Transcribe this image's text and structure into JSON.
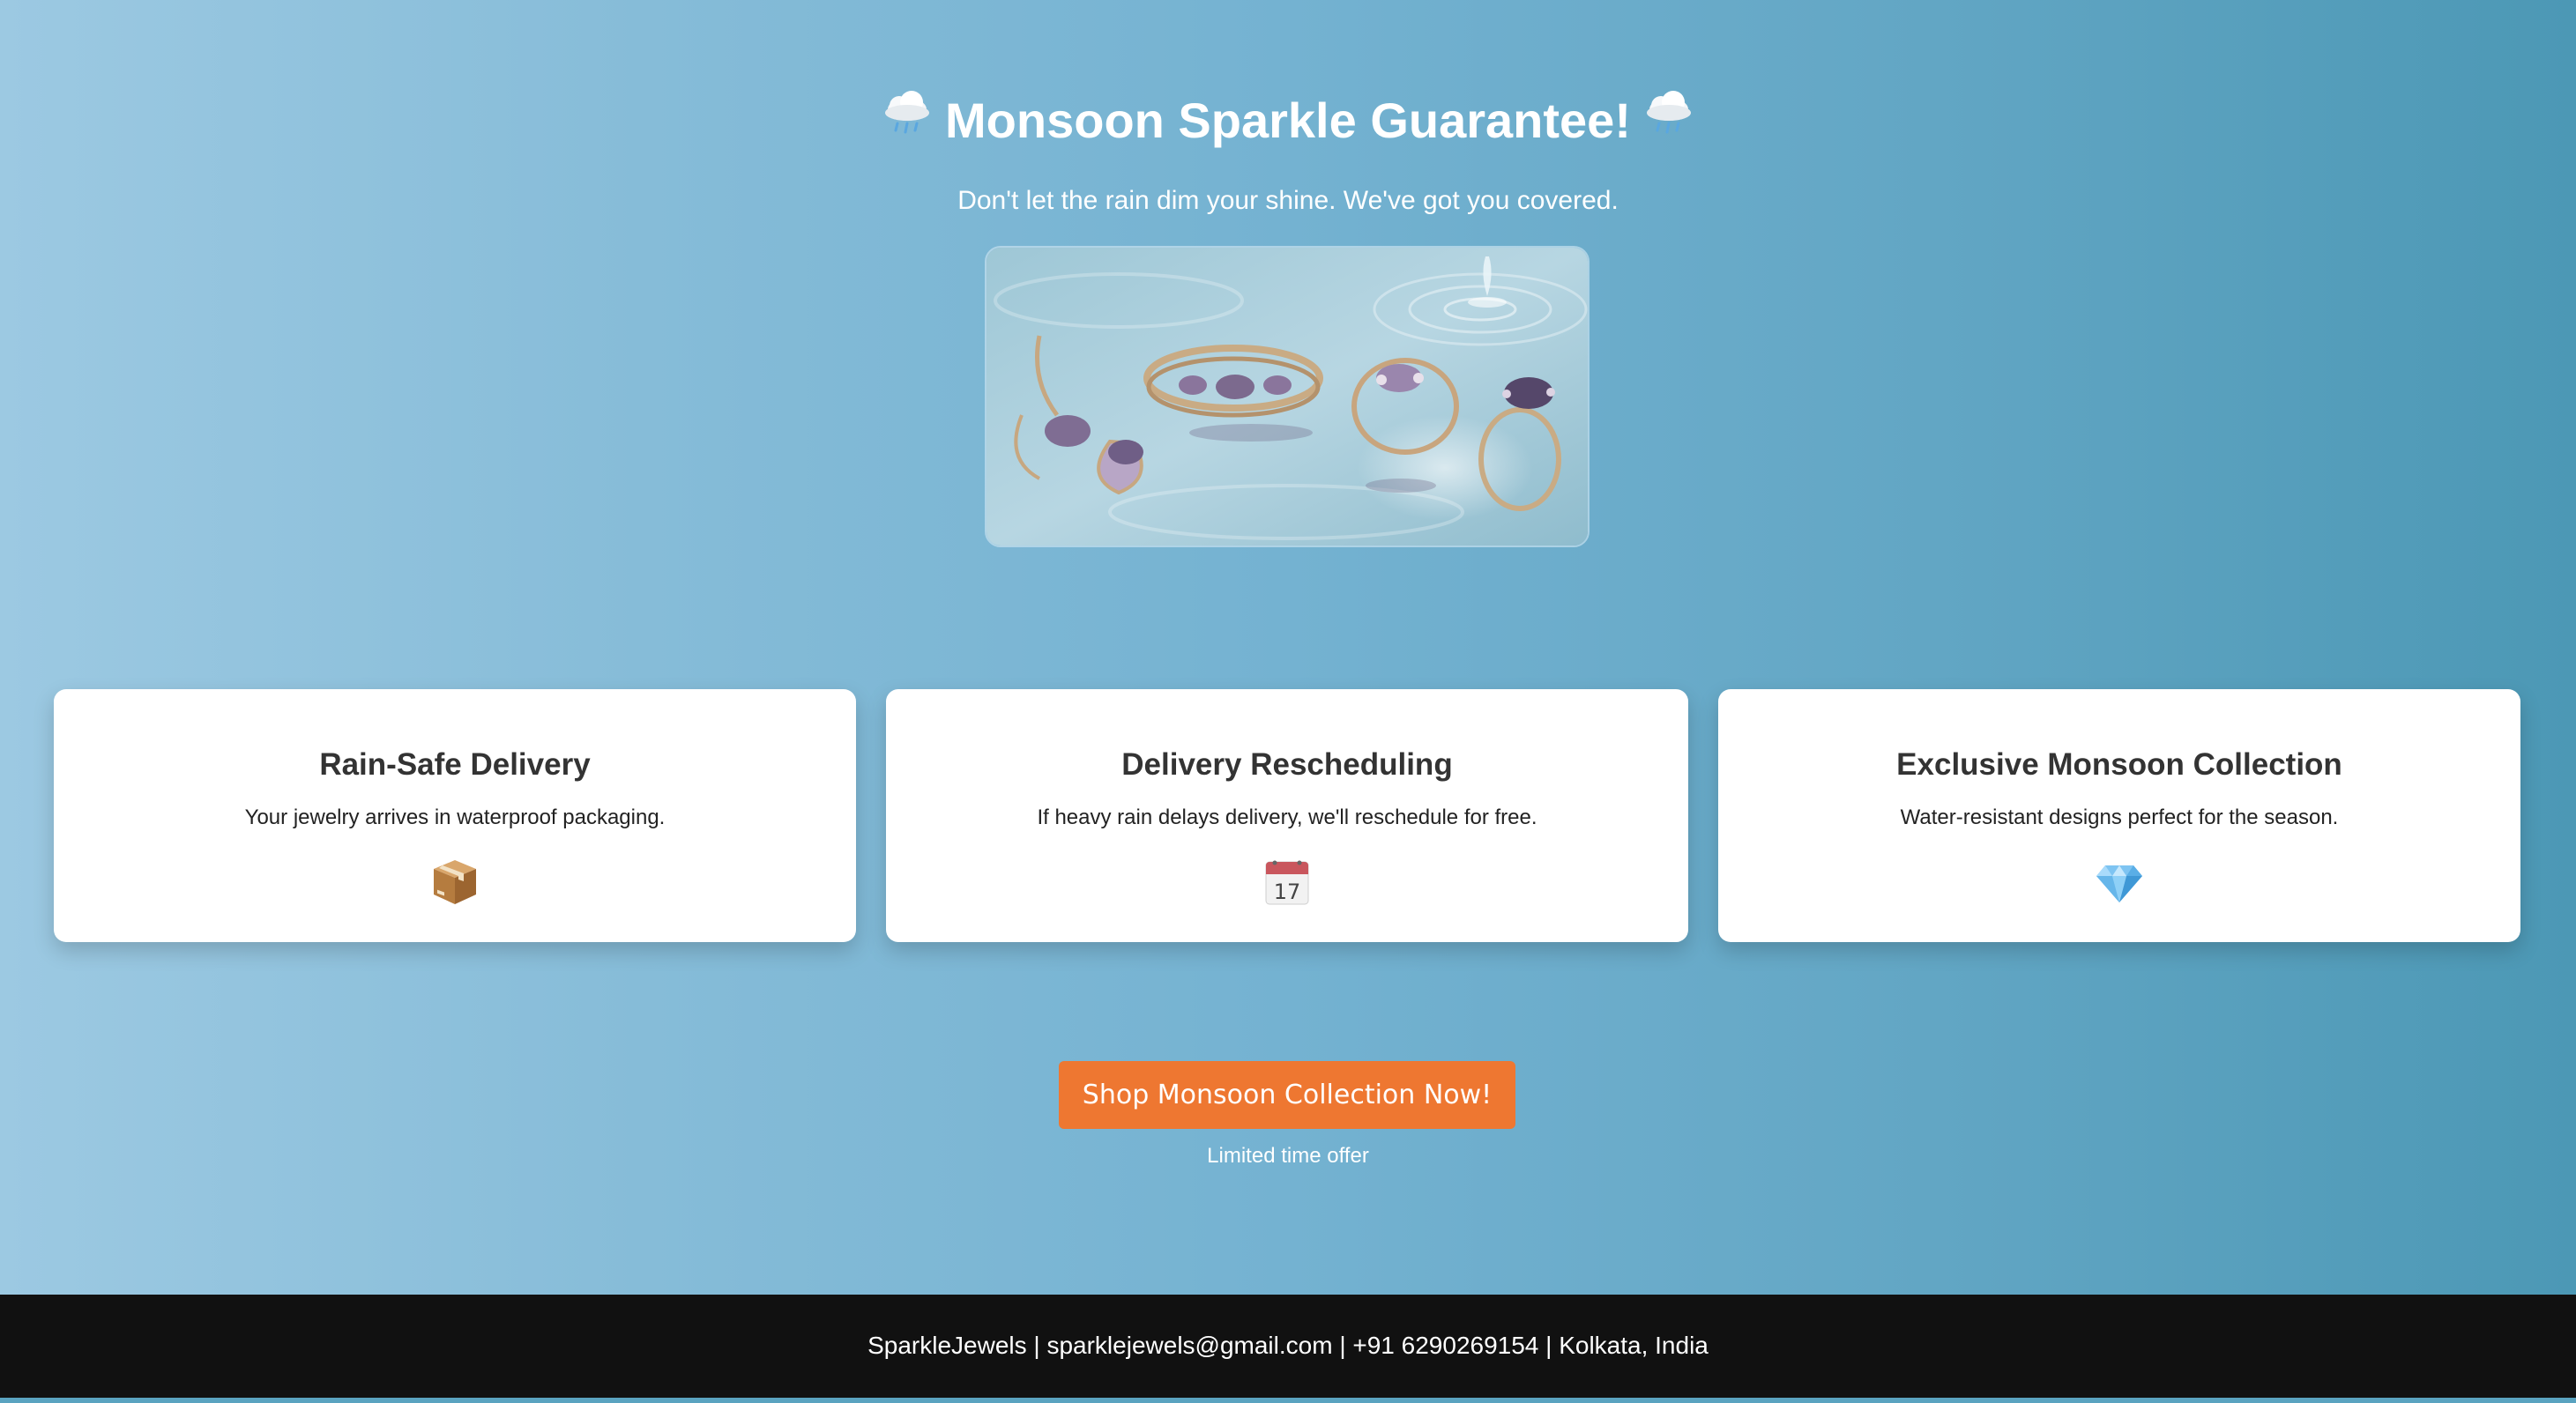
{
  "hero": {
    "title": "Monsoon Sparkle Guarantee!",
    "title_icon": "cloud-with-rain-icon",
    "subtitle": "Don't let the rain dim your shine. We've got you covered."
  },
  "features": [
    {
      "title": "Rain-Safe Delivery",
      "description": "Your jewelry arrives in waterproof packaging.",
      "icon": "package-icon"
    },
    {
      "title": "Delivery Rescheduling",
      "description": "If heavy rain delays delivery, we'll reschedule for free.",
      "icon": "calendar-icon",
      "icon_text": "17"
    },
    {
      "title": "Exclusive Monsoon Collection",
      "description": "Water-resistant designs perfect for the season.",
      "icon": "gem-icon"
    }
  ],
  "cta": {
    "label": "Shop Monsoon Collection Now!",
    "note": "Limited time offer"
  },
  "footer": {
    "text": "SparkleJewels | sparklejewels@gmail.com | +91 6290269154 | Kolkata, India"
  },
  "colors": {
    "cta": "#ee7731",
    "footer_bg": "#111111",
    "gradient_start": "#9cc9e2",
    "gradient_end": "#4c98b5"
  }
}
